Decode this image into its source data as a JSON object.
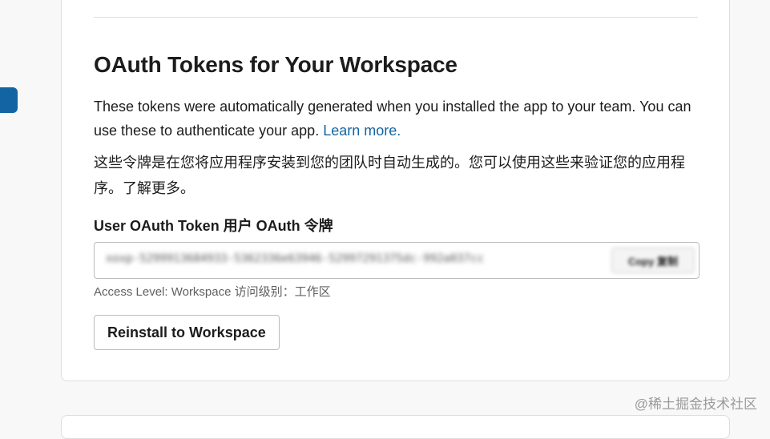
{
  "section": {
    "title": "OAuth Tokens for Your Workspace",
    "description": "These tokens were automatically generated when you installed the app to your team. You can use these to authenticate your app.",
    "learn_more_link": "Learn more.",
    "description_cn": "这些令牌是在您将应用程序安装到您的团队时自动生成的。您可以使用这些来验证您的应用程序。了解更多。"
  },
  "token_field": {
    "label": "User OAuth Token 用户 OAuth 令牌",
    "value": "xoxp-5299913684933-5362336e63946-52997291375dc-992a037cc",
    "copy_label": "Copy 复制",
    "access_level": "Access Level: Workspace 访问级别：工作区"
  },
  "actions": {
    "reinstall_label": "Reinstall to Workspace"
  },
  "watermark": "@稀土掘金技术社区",
  "colors": {
    "accent": "#1264a3",
    "text": "#1d1c1d",
    "muted": "#616061"
  }
}
